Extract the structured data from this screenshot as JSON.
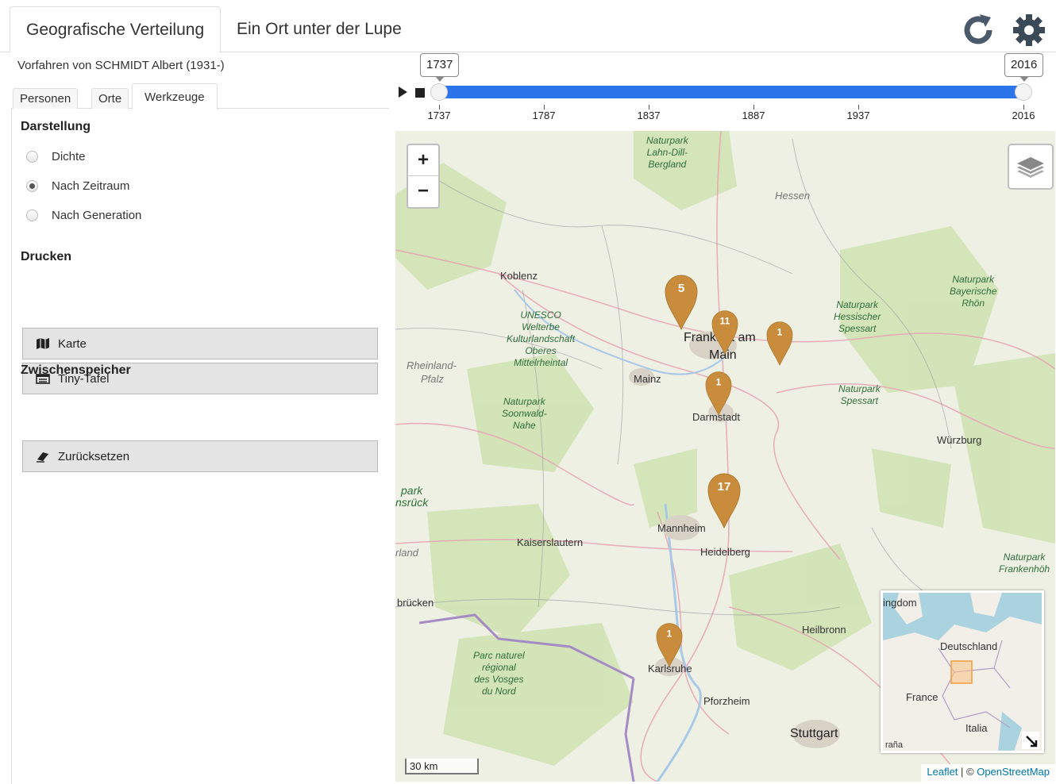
{
  "header": {
    "tabs": [
      {
        "label": "Geografische Verteilung",
        "active": true
      },
      {
        "label": "Ein Ort unter der Lupe",
        "active": false
      }
    ],
    "icons": [
      "refresh-icon",
      "gear-icon"
    ]
  },
  "left": {
    "title": "Vorfahren von SCHMIDT Albert (1931-)",
    "subtabs": [
      {
        "label": "Personen"
      },
      {
        "label": "Orte"
      },
      {
        "label": "Werkzeuge",
        "active": true
      }
    ],
    "darstellung": {
      "heading": "Darstellung",
      "options": [
        {
          "label": "Dichte",
          "checked": false
        },
        {
          "label": "Nach Zeitraum",
          "checked": true
        },
        {
          "label": "Nach Generation",
          "checked": false
        }
      ]
    },
    "drucken": {
      "heading": "Drucken",
      "buttons": [
        {
          "label": "Karte",
          "icon": "map-icon"
        },
        {
          "label": "Tiny-Tafel",
          "icon": "table-icon"
        }
      ]
    },
    "zwischenspeicher": {
      "heading": "Zwischenspeicher",
      "buttons": [
        {
          "label": "Zurücksetzen",
          "icon": "eraser-icon"
        }
      ]
    }
  },
  "slider": {
    "min": 1737,
    "max": 2016,
    "value_from": "1737",
    "value_to": "2016",
    "ticks": [
      "1737",
      "1787",
      "1837",
      "1887",
      "1937",
      "2016"
    ],
    "fill_color": "#2b74ea"
  },
  "map": {
    "zoom_in": "+",
    "zoom_out": "−",
    "places": [
      "Koblenz",
      "Mainz",
      "Darmstadt",
      "Würzburg",
      "Mannheim",
      "Kaiserslautern",
      "Heidelberg",
      "Heilbronn",
      "Karlsruhe",
      "Pforzheim",
      "Stuttgart",
      "brücken",
      "rland"
    ],
    "frankfurt": [
      "Frankfurt am",
      "Main"
    ],
    "regions": [
      "Hessen",
      "Rheinland-",
      "Pfalz"
    ],
    "parks": [
      "Naturpark\nLahn-Dill-\nBergland",
      "UNESCO\nWelterbe\nKulturlandschaft\nOberes\nMittelrheintal",
      "Naturpark\nHessischer\nSpessart",
      "Naturpark\nBayerische\nRhön",
      "Naturpark\nSpessart",
      "Naturpark\nSoonwald-\nNahe",
      "Naturpark\nFrankenhöh",
      "Parc naturel\nrégional\ndes Vosges\ndu Nord",
      "park\nnsrück"
    ],
    "markers": [
      "5",
      "11",
      "1",
      "1",
      "17",
      "1"
    ],
    "marker_color": "#c98c3c",
    "minimap_labels": [
      "ingdom",
      "Deutschland",
      "France",
      "Italia",
      "raña"
    ],
    "scale": "30 km",
    "attribution_leaflet": "Leaflet",
    "attribution_sep": " | © ",
    "attribution_osm": "OpenStreetMap"
  }
}
